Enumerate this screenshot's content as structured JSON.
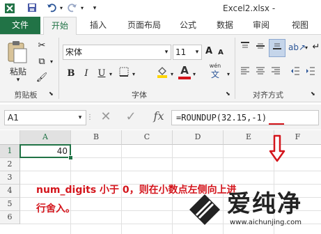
{
  "window": {
    "filename": "Excel2.xlsx -"
  },
  "quick_access": {
    "save_icon": "save-icon",
    "undo_icon": "undo-icon",
    "redo_icon": "redo-icon",
    "customize_icon": "customize-icon"
  },
  "tabs": [
    {
      "label": "文件",
      "active": false,
      "file": true
    },
    {
      "label": "开始",
      "active": true
    },
    {
      "label": "插入",
      "active": false
    },
    {
      "label": "页面布局",
      "active": false
    },
    {
      "label": "公式",
      "active": false
    },
    {
      "label": "数据",
      "active": false
    },
    {
      "label": "审阅",
      "active": false
    },
    {
      "label": "视图",
      "active": false
    }
  ],
  "ribbon": {
    "clipboard": {
      "paste_label": "粘贴",
      "group_label": "剪贴板"
    },
    "font": {
      "font_name": "宋体",
      "font_size": "11",
      "bold": "B",
      "italic": "I",
      "underline": "U",
      "font_color_label": "A",
      "wen_label": "wén",
      "group_label": "字体",
      "grow_label": "A",
      "shrink_label": "A"
    },
    "alignment": {
      "group_label": "对齐方式"
    }
  },
  "formula_bar": {
    "name_box": "A1",
    "fx": "fx",
    "formula": "=ROUNDUP(32.15,-1)"
  },
  "sheet": {
    "columns": [
      "A",
      "B",
      "C",
      "D",
      "E",
      "F"
    ],
    "rows": [
      "1",
      "2",
      "3",
      "4",
      "5",
      "6"
    ],
    "a1_value": "40"
  },
  "annotation": {
    "line1": "num_digits 小于 0，则在小数点左侧向上进",
    "line2": "行舍入。"
  },
  "watermark": {
    "text": "爱纯净",
    "url": "www.aichunjing.com"
  },
  "colors": {
    "file_tab": "#217346",
    "accent": "#217346",
    "annotation": "#d4151c"
  }
}
